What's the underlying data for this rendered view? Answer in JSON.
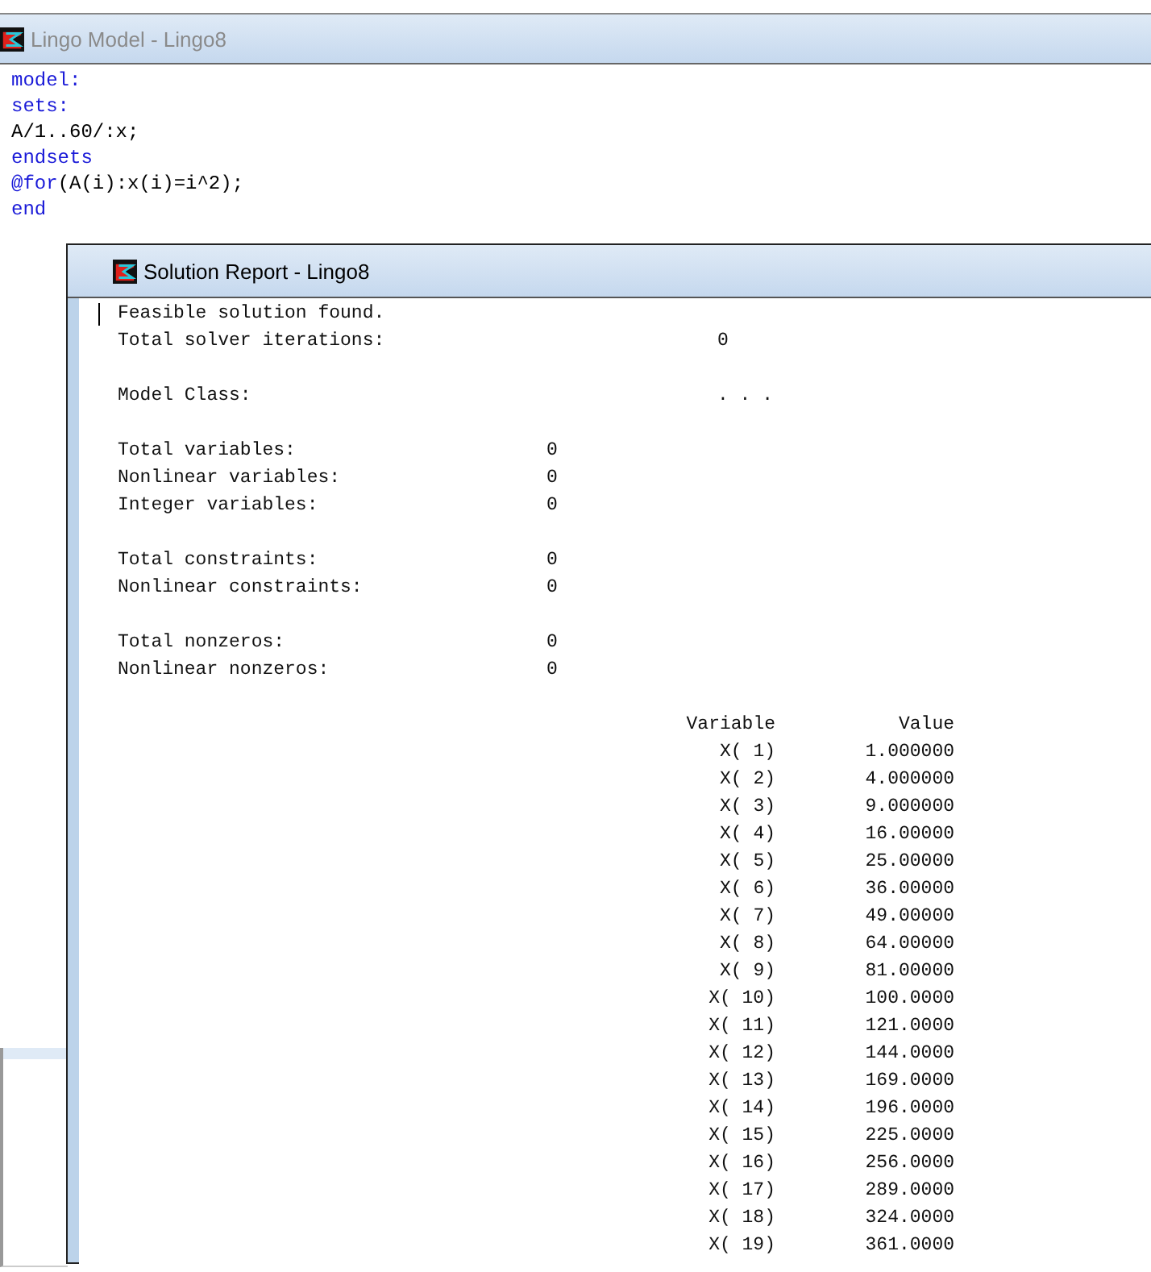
{
  "model_window": {
    "title": "Lingo Model - Lingo8",
    "code": [
      {
        "text": "model:",
        "kind": "keyword"
      },
      {
        "text": "sets:",
        "kind": "keyword"
      },
      {
        "text": "A/1..60/:x;",
        "kind": "plain"
      },
      {
        "text": "endsets",
        "kind": "keyword"
      },
      {
        "text": "@for(A(i):x(i)=i^2);",
        "kind": "call"
      },
      {
        "text": "end",
        "kind": "keyword"
      }
    ]
  },
  "report_window": {
    "title": "Solution Report - Lingo8",
    "groups": [
      [
        {
          "label": "Feasible solution found."
        },
        {
          "label": "Total solver iterations:",
          "value": "0",
          "kind": "far"
        }
      ],
      [
        {
          "label": "Model Class:",
          "value": ". . .",
          "kind": "far"
        }
      ],
      [
        {
          "label": "Total variables:",
          "value": "0",
          "kind": "near"
        },
        {
          "label": "Nonlinear variables:",
          "value": "0",
          "kind": "near"
        },
        {
          "label": "Integer variables:",
          "value": "0",
          "kind": "near"
        }
      ],
      [
        {
          "label": "Total constraints:",
          "value": "0",
          "kind": "near"
        },
        {
          "label": "Nonlinear constraints:",
          "value": "0",
          "kind": "near"
        }
      ],
      [
        {
          "label": "Total nonzeros:",
          "value": "0",
          "kind": "near"
        },
        {
          "label": "Nonlinear nonzeros:",
          "value": "0",
          "kind": "near"
        }
      ]
    ],
    "table": {
      "columns": [
        "Variable",
        "Value"
      ],
      "rows": [
        [
          "X( 1)",
          "1.000000"
        ],
        [
          "X( 2)",
          "4.000000"
        ],
        [
          "X( 3)",
          "9.000000"
        ],
        [
          "X( 4)",
          "16.00000"
        ],
        [
          "X( 5)",
          "25.00000"
        ],
        [
          "X( 6)",
          "36.00000"
        ],
        [
          "X( 7)",
          "49.00000"
        ],
        [
          "X( 8)",
          "64.00000"
        ],
        [
          "X( 9)",
          "81.00000"
        ],
        [
          "X( 10)",
          "100.0000"
        ],
        [
          "X( 11)",
          "121.0000"
        ],
        [
          "X( 12)",
          "144.0000"
        ],
        [
          "X( 13)",
          "169.0000"
        ],
        [
          "X( 14)",
          "196.0000"
        ],
        [
          "X( 15)",
          "225.0000"
        ],
        [
          "X( 16)",
          "256.0000"
        ],
        [
          "X( 17)",
          "289.0000"
        ],
        [
          "X( 18)",
          "324.0000"
        ],
        [
          "X( 19)",
          "361.0000"
        ]
      ]
    }
  }
}
